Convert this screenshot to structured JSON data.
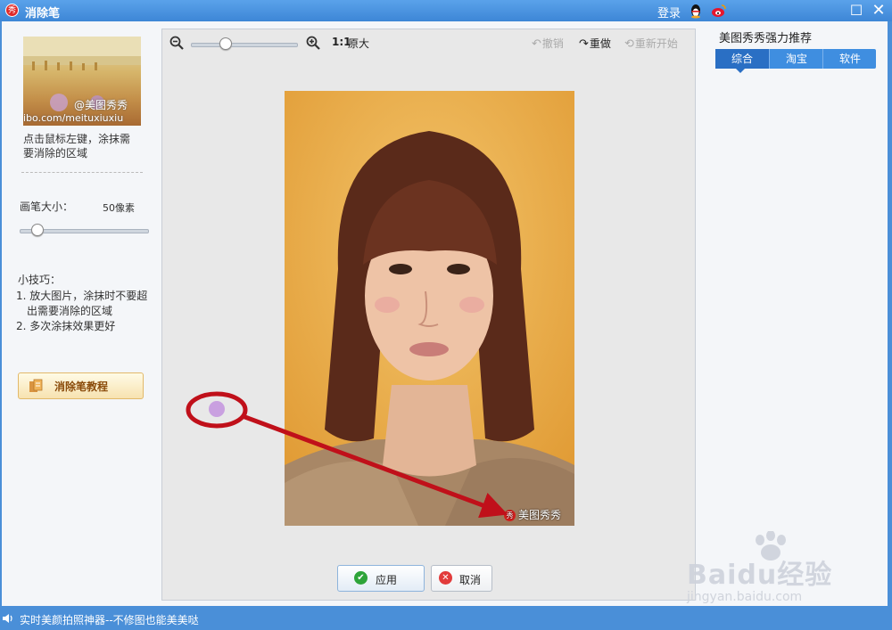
{
  "titlebar": {
    "title": "消除笔",
    "app_logo": "秀",
    "login": "登录",
    "qq_icon": "qq-penguin-icon",
    "weibo_icon": "weibo-icon"
  },
  "left": {
    "thumb_caption": "ibo.com/meituxiuxiu",
    "thumb_logo": "@美图秀秀",
    "instruction": "点击鼠标左键，涂抹需要消除的区域",
    "brush_label": "画笔大小：",
    "brush_value": "50像素",
    "brush_level": 0.1,
    "tips_title": "小技巧：",
    "tips": [
      "1. 放大图片，涂抹时不要超",
      "出需要消除的区域",
      "2. 多次涂抹效果更好"
    ],
    "tutorial_label": "消除笔教程"
  },
  "toolbar": {
    "ratio": "1:1",
    "original": "原大",
    "undo": "撤销",
    "redo": "重做",
    "restart": "重新开始",
    "zoom_level": 0.3
  },
  "photo": {
    "watermark_logo": "秀",
    "watermark": "美图秀秀"
  },
  "buttons": {
    "apply": "应用",
    "cancel": "取消"
  },
  "right": {
    "title": "美图秀秀强力推荐",
    "tabs": [
      "综合",
      "淘宝",
      "软件"
    ]
  },
  "status": {
    "text": "实时美颜拍照神器--不修图也能美美哒"
  },
  "baidu_watermark": {
    "text": "Baidu经验",
    "url": "jingyan.baidu.com"
  },
  "colors": {
    "titlebar": "#3d86d6",
    "accent_tab": "#2a6fc4",
    "annotation": "#c0101a",
    "brush_dot": "#c9a0e0",
    "photo_bg": "#e9ad4e"
  }
}
